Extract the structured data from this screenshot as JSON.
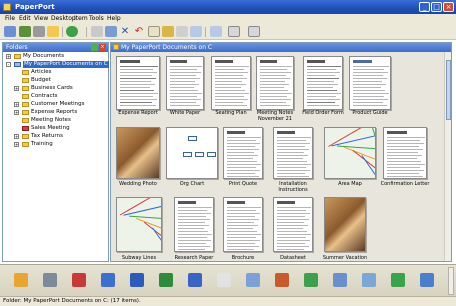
{
  "window": {
    "title": "PaperPort"
  },
  "menu": [
    "File",
    "Edit",
    "View",
    "Desktop",
    "Item",
    "Tools",
    "Help"
  ],
  "toolbar_icons": [
    "view-toggle-icon",
    "scan-icon",
    "find-icon",
    "folder-icon",
    "back-icon",
    "print-icon",
    "open-icon",
    "delete-icon",
    "undo-icon",
    "properties-icon",
    "stack-icon",
    "unstack-icon",
    "page-icon",
    "annotation-icon",
    "zoom-icon",
    "tools-icon"
  ],
  "folders_pane": {
    "title": "Folders",
    "items": [
      {
        "label": "My Documents",
        "level": 0,
        "toggle": "+",
        "icon": "folder"
      },
      {
        "label": "My PaperPort Documents on C",
        "level": 0,
        "toggle": "-",
        "icon": "pc",
        "selected": true
      },
      {
        "label": "Articles",
        "level": 1,
        "toggle": "",
        "icon": "folder"
      },
      {
        "label": "Budget",
        "level": 1,
        "toggle": "",
        "icon": "folder"
      },
      {
        "label": "Business Cards",
        "level": 1,
        "toggle": "+",
        "icon": "folder"
      },
      {
        "label": "Contracts",
        "level": 1,
        "toggle": "",
        "icon": "folder"
      },
      {
        "label": "Customer Meetings",
        "level": 1,
        "toggle": "+",
        "icon": "folder"
      },
      {
        "label": "Expense Reports",
        "level": 1,
        "toggle": "+",
        "icon": "folder"
      },
      {
        "label": "Meeting Notes",
        "level": 1,
        "toggle": "",
        "icon": "folder"
      },
      {
        "label": "Sales Meeting",
        "level": 1,
        "toggle": "",
        "icon": "red"
      },
      {
        "label": "Tax Returns",
        "level": 1,
        "toggle": "+",
        "icon": "folder"
      },
      {
        "label": "Training",
        "level": 1,
        "toggle": "+",
        "icon": "folder"
      }
    ]
  },
  "doc_pane": {
    "title": "My PaperPort Documents on C"
  },
  "thumbnails": [
    {
      "label": "Expense Report",
      "kind": "form"
    },
    {
      "label": "White Paper",
      "kind": "text"
    },
    {
      "label": "Seating Plan",
      "kind": "text"
    },
    {
      "label": "Meeting Notes November 21",
      "kind": "text"
    },
    {
      "label": "Field Order Form",
      "kind": "form"
    },
    {
      "label": "Product Guide",
      "kind": "table"
    },
    {
      "label": "Wedding Photo",
      "kind": "photo"
    },
    {
      "label": "Org Chart",
      "kind": "chart"
    },
    {
      "label": "Print Quote",
      "kind": "text"
    },
    {
      "label": "Installation Instructions",
      "kind": "text"
    },
    {
      "label": "Area Map",
      "kind": "map"
    },
    {
      "label": "Confirmation Letter",
      "kind": "text"
    },
    {
      "label": "Subway Lines",
      "kind": "map"
    },
    {
      "label": "Research Paper",
      "kind": "text"
    },
    {
      "label": "Brochure",
      "kind": "text"
    },
    {
      "label": "Datasheet",
      "kind": "text"
    },
    {
      "label": "Summer Vacation",
      "kind": "photo"
    }
  ],
  "sendto_icons": [
    "image-editor-icon",
    "mail-icon",
    "acrobat-icon",
    "fax-icon",
    "word-icon",
    "excel-icon",
    "word-doc-icon",
    "notepad-icon",
    "text-icon",
    "paint-icon",
    "browser-icon",
    "calendar-icon",
    "cd-icon",
    "recycle-icon",
    "export-icon"
  ],
  "status": {
    "text": "Folder: My PaperPort Documents on C: (17 items)."
  },
  "colors": {
    "title_blue": "#1f4fb8",
    "selection": "#316ac5",
    "pane_bg": "#e8e6dc"
  }
}
